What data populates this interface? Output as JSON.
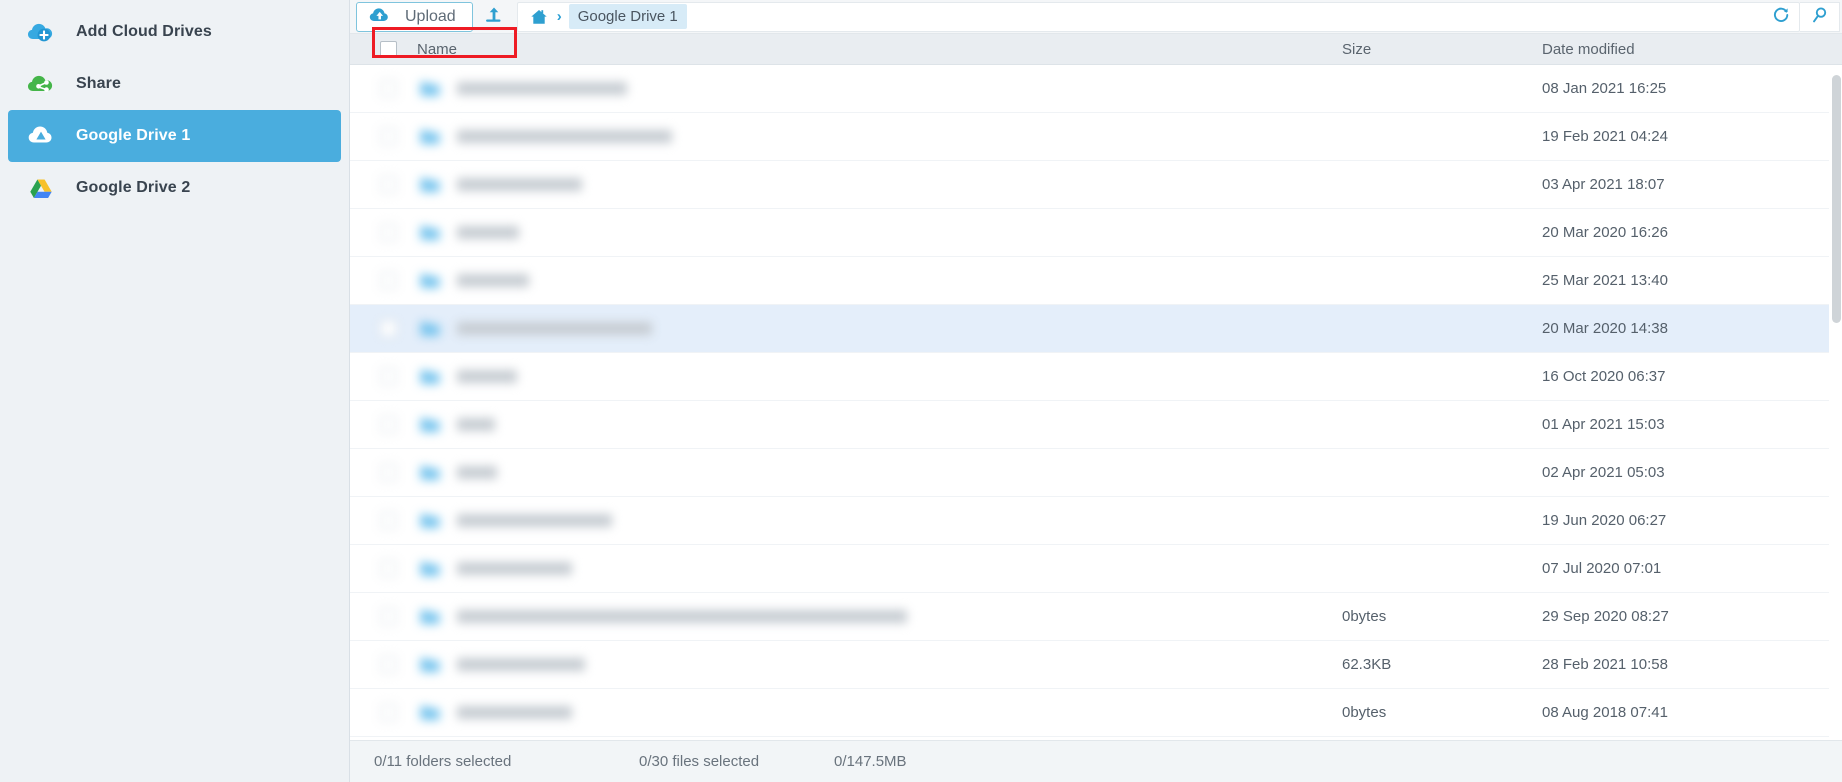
{
  "sidebar": {
    "items": [
      {
        "label": "Add Cloud Drives",
        "icon": "cloud-plus-icon",
        "active": false
      },
      {
        "label": "Share",
        "icon": "cloud-share-icon",
        "active": false
      },
      {
        "label": "Google Drive 1",
        "icon": "google-drive-white-icon",
        "active": true
      },
      {
        "label": "Google Drive 2",
        "icon": "google-drive-color-icon",
        "active": false
      }
    ]
  },
  "toolbar": {
    "upload_label": "Upload",
    "upload_icon": "cloud-upload-icon",
    "up_level_icon": "arrow-up-level-icon",
    "home_icon": "home-icon",
    "breadcrumb_separator": "›",
    "breadcrumb": [
      "Google Drive 1"
    ],
    "refresh_icon": "refresh-icon",
    "search_icon": "search-icon"
  },
  "columns": {
    "name": "Name",
    "size": "Size",
    "date_modified": "Date modified"
  },
  "rows": [
    {
      "name": "",
      "size": "",
      "date": "08 Jan 2021 16:25",
      "selected": false
    },
    {
      "name": "",
      "size": "",
      "date": "19 Feb 2021 04:24",
      "selected": false
    },
    {
      "name": "",
      "size": "",
      "date": "03 Apr 2021 18:07",
      "selected": false
    },
    {
      "name": "",
      "size": "",
      "date": "20 Mar 2020 16:26",
      "selected": false
    },
    {
      "name": "",
      "size": "",
      "date": "25 Mar 2021 13:40",
      "selected": false
    },
    {
      "name": "",
      "size": "",
      "date": "20 Mar 2020 14:38",
      "selected": true
    },
    {
      "name": "",
      "size": "",
      "date": "16 Oct 2020 06:37",
      "selected": false
    },
    {
      "name": "",
      "size": "",
      "date": "01 Apr 2021 15:03",
      "selected": false
    },
    {
      "name": "",
      "size": "",
      "date": "02 Apr 2021 05:03",
      "selected": false
    },
    {
      "name": "",
      "size": "",
      "date": "19 Jun 2020 06:27",
      "selected": false
    },
    {
      "name": "",
      "size": "",
      "date": "07 Jul 2020 07:01",
      "selected": false
    },
    {
      "name": "",
      "size": "0bytes",
      "date": "29 Sep 2020 08:27",
      "selected": false
    },
    {
      "name": "",
      "size": "62.3KB",
      "date": "28 Feb 2021 10:58",
      "selected": false
    },
    {
      "name": "",
      "size": "0bytes",
      "date": "08 Aug 2018 07:41",
      "selected": false
    }
  ],
  "statusbar": {
    "folders_selected": "0/11 folders selected",
    "files_selected": "0/30 files selected",
    "size_selected": "0/147.5MB"
  },
  "annotation": {
    "highlight_color": "#ee1b24",
    "target": "name-column-header"
  },
  "colors": {
    "accent": "#4aadde",
    "sidebar_bg": "#eef2f5",
    "selected_row": "#e4eefa",
    "header_bg": "#e9edf1"
  }
}
